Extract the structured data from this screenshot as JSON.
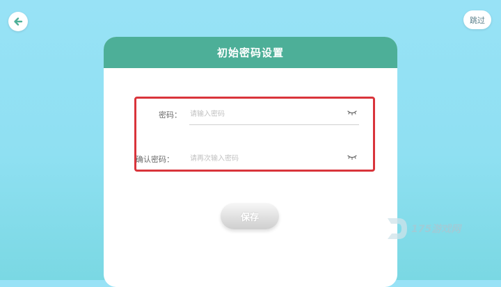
{
  "header": {
    "back_icon": "arrow-left-icon",
    "skip_label": "跳过"
  },
  "card": {
    "title": "初始密码设置",
    "password": {
      "label": "密码：",
      "placeholder": "请输入密码",
      "value": "",
      "toggle_icon": "eye-closed-icon"
    },
    "confirm_password": {
      "label": "确认密码：",
      "placeholder": "请再次输入密码",
      "value": "",
      "toggle_icon": "eye-closed-icon"
    },
    "save_label": "保存"
  },
  "watermark": {
    "text": "175游戏网"
  },
  "colors": {
    "background": "#98e2f6",
    "card_header": "#4daf98",
    "highlight_border": "#d9343b",
    "save_button": "#e0e0e0"
  }
}
